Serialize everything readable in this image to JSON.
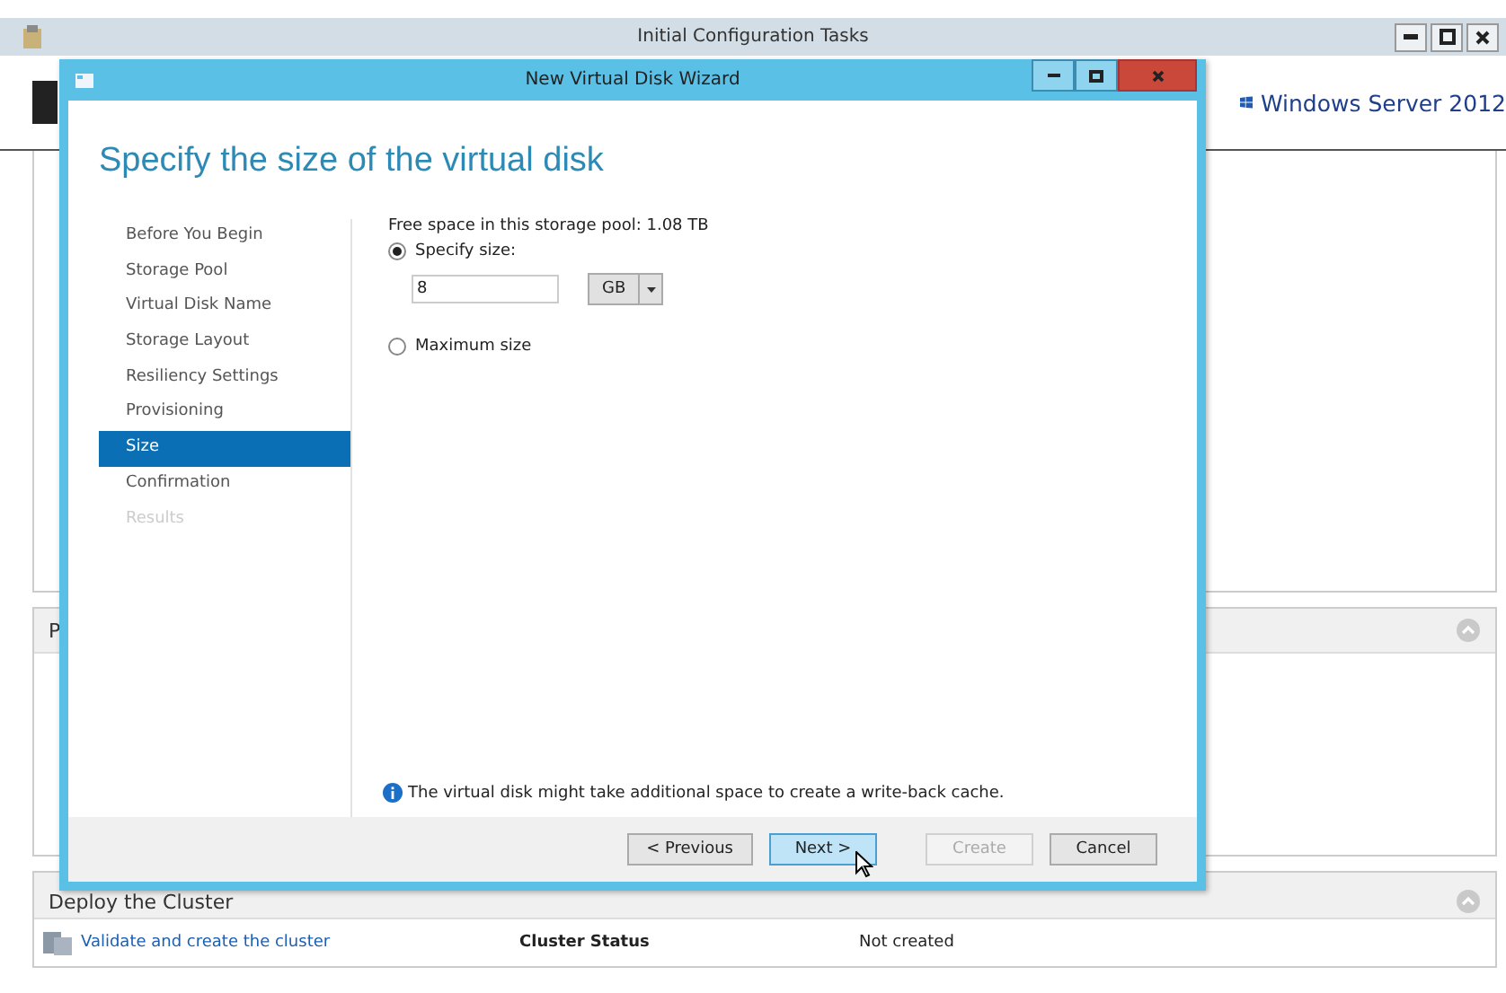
{
  "window": {
    "title": "Initial Configuration Tasks"
  },
  "header": {
    "brand": "Windows Server 2012"
  },
  "section_partial": {
    "title": "P"
  },
  "deploy_section": {
    "title": "Deploy the Cluster",
    "link": "Validate and create the cluster",
    "status_label": "Cluster Status",
    "status_value": "Not created"
  },
  "wizard": {
    "title": "New Virtual Disk Wizard",
    "heading": "Specify the size of the virtual disk",
    "steps": [
      {
        "label": "Before You Begin",
        "selected": false,
        "disabled": false
      },
      {
        "label": "Storage Pool",
        "selected": false,
        "disabled": false
      },
      {
        "label": "Virtual Disk Name",
        "selected": false,
        "disabled": false
      },
      {
        "label": "Storage Layout",
        "selected": false,
        "disabled": false
      },
      {
        "label": "Resiliency Settings",
        "selected": false,
        "disabled": false
      },
      {
        "label": "Provisioning",
        "selected": false,
        "disabled": false
      },
      {
        "label": "Size",
        "selected": true,
        "disabled": false
      },
      {
        "label": "Confirmation",
        "selected": false,
        "disabled": false
      },
      {
        "label": "Results",
        "selected": false,
        "disabled": true
      }
    ],
    "free_space": "Free space in this storage pool: 1.08 TB",
    "options": [
      {
        "label": "Specify size:",
        "selected": true
      },
      {
        "label": "Maximum size",
        "selected": false
      }
    ],
    "size_value": "8",
    "unit": "GB",
    "info": "The virtual disk might take additional space to create a write-back cache.",
    "buttons": [
      {
        "label": "< Previous",
        "disabled": false,
        "highlighted": false
      },
      {
        "label": "Next >",
        "disabled": false,
        "highlighted": true
      },
      {
        "label": "Create",
        "disabled": true,
        "highlighted": false
      },
      {
        "label": "Cancel",
        "disabled": false,
        "highlighted": false
      }
    ]
  }
}
